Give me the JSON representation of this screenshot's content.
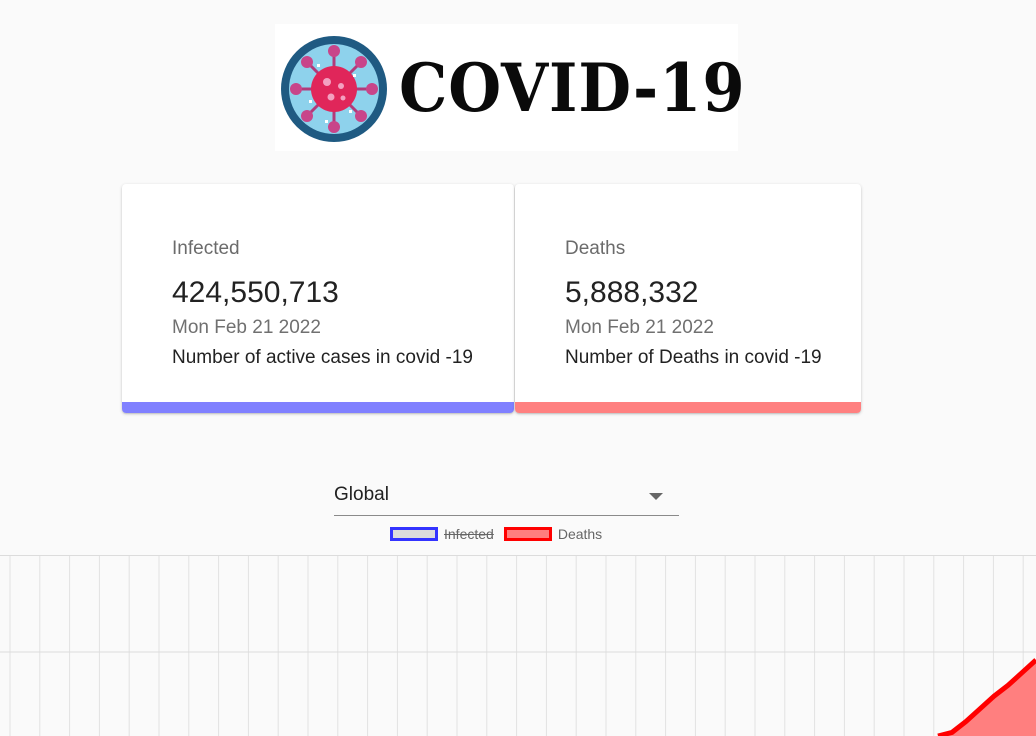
{
  "header": {
    "logo_text": "COVID-19"
  },
  "cards": {
    "infected": {
      "title": "Infected",
      "value": "424,550,713",
      "date": "Mon Feb 21 2022",
      "description": "Number of active cases in covid -19",
      "accent_color": "#8080ff"
    },
    "deaths": {
      "title": "Deaths",
      "value": "5,888,332",
      "date": "Mon Feb 21 2022",
      "description": "Number of Deaths in covid -19",
      "accent_color": "#ff8080"
    }
  },
  "country_select": {
    "selected": "Global"
  },
  "chart_data": {
    "type": "area",
    "title": "",
    "xlabel": "",
    "ylabel": "",
    "grid": true,
    "legend_placement": "top-center",
    "series": [
      {
        "name": "Infected",
        "hidden": true,
        "border_color": "#3333ff",
        "fill_color": "#dcdcdc"
      },
      {
        "name": "Deaths",
        "hidden": false,
        "border_color": "#ff0000",
        "fill_color": "#ff7f7f",
        "values_fraction_of_visible_height": [
          0,
          0.02,
          0.08,
          0.15,
          0.22,
          0.28,
          0.35,
          0.42
        ]
      }
    ]
  }
}
